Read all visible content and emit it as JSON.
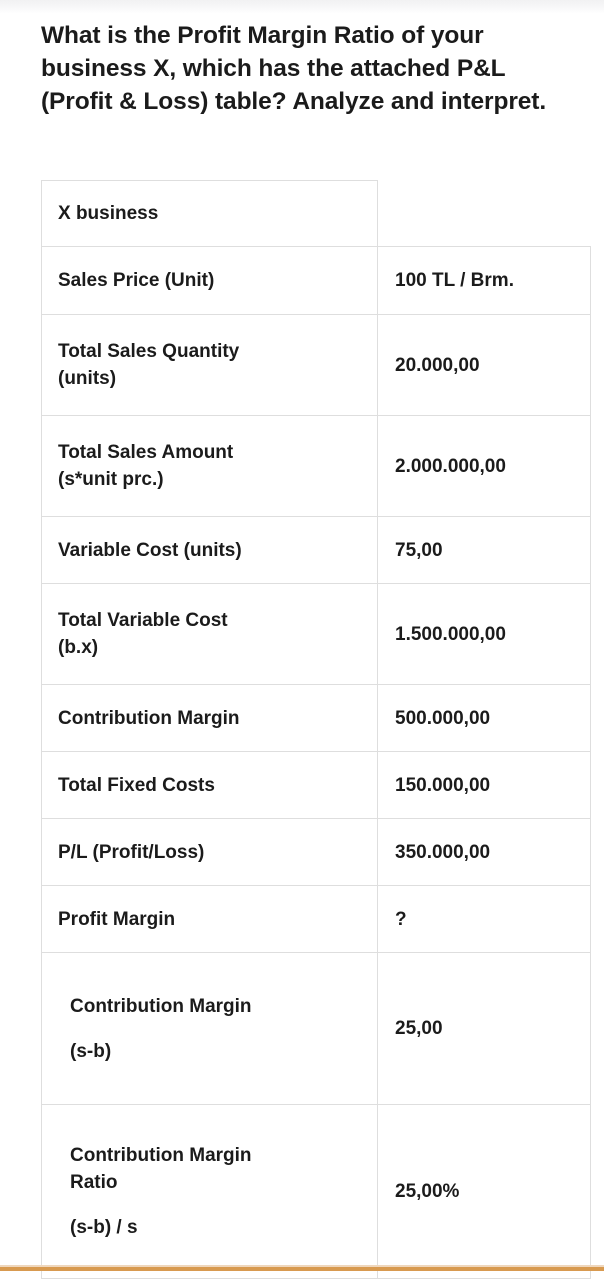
{
  "question": {
    "text": "What is the Profit Margin Ratio of your business X, which has the attached P&L (Profit & Loss) table? Analyze and interpret."
  },
  "table": {
    "title_row": {
      "label": "X business",
      "value": ""
    },
    "rows": [
      {
        "label": "Sales Price (Unit)",
        "value": "100 TL / Brm."
      },
      {
        "label_line1": "Total Sales Quantity",
        "label_line2": "(units)",
        "value": "20.000,00"
      },
      {
        "label_line1": "Total Sales Amount",
        "label_line2": "(s*unit prc.)",
        "value": "2.000.000,00"
      },
      {
        "label": "Variable Cost (units)",
        "value": "75,00"
      },
      {
        "label_line1": "Total Variable Cost",
        "label_line2": "(b.x)",
        "value": "1.500.000,00"
      },
      {
        "label": "Contribution Margin",
        "value": "500.000,00"
      },
      {
        "label": "Total Fixed Costs",
        "value": "150.000,00"
      },
      {
        "label": "P/L (Profit/Loss)",
        "value": "350.000,00"
      },
      {
        "label": "Profit Margin",
        "value": "?"
      },
      {
        "label_line1": "Contribution Margin",
        "label_line2": "(s-b)",
        "value": "25,00"
      },
      {
        "label_line1": "Contribution Margin",
        "label_line2": "Ratio",
        "label_line3": "(s-b) / s",
        "value": "25,00%"
      }
    ]
  },
  "colors": {
    "text": "#1b1b1b",
    "border": "#dedede",
    "accent_rule": "#d89a50",
    "background": "#ffffff"
  }
}
